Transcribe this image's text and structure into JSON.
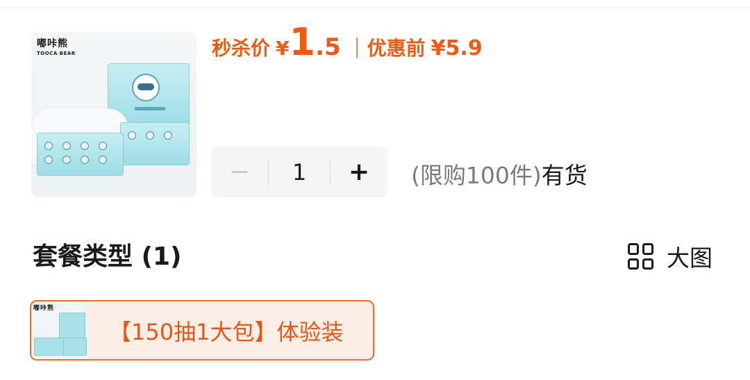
{
  "product": {
    "brand_cn": "嘟咔熊",
    "brand_en": "TOOCA BEAR"
  },
  "price": {
    "flash_label": "秒杀价",
    "currency": "¥",
    "flash_int": "1",
    "flash_dec": ".5",
    "original_label": "优惠前",
    "original_value": "¥5.9",
    "accent_color": "#ef5a13"
  },
  "quantity": {
    "minus": "−",
    "value": "1",
    "plus": "+",
    "limit_text": "(限购100件)",
    "stock_text": "有货"
  },
  "section": {
    "title": "套餐类型 (1)",
    "view_label": "大图"
  },
  "options": [
    {
      "label": "【150抽1大包】体验装",
      "selected": true
    }
  ],
  "icons": {
    "grid": "grid-view-icon",
    "product": "product-thumbnail"
  }
}
